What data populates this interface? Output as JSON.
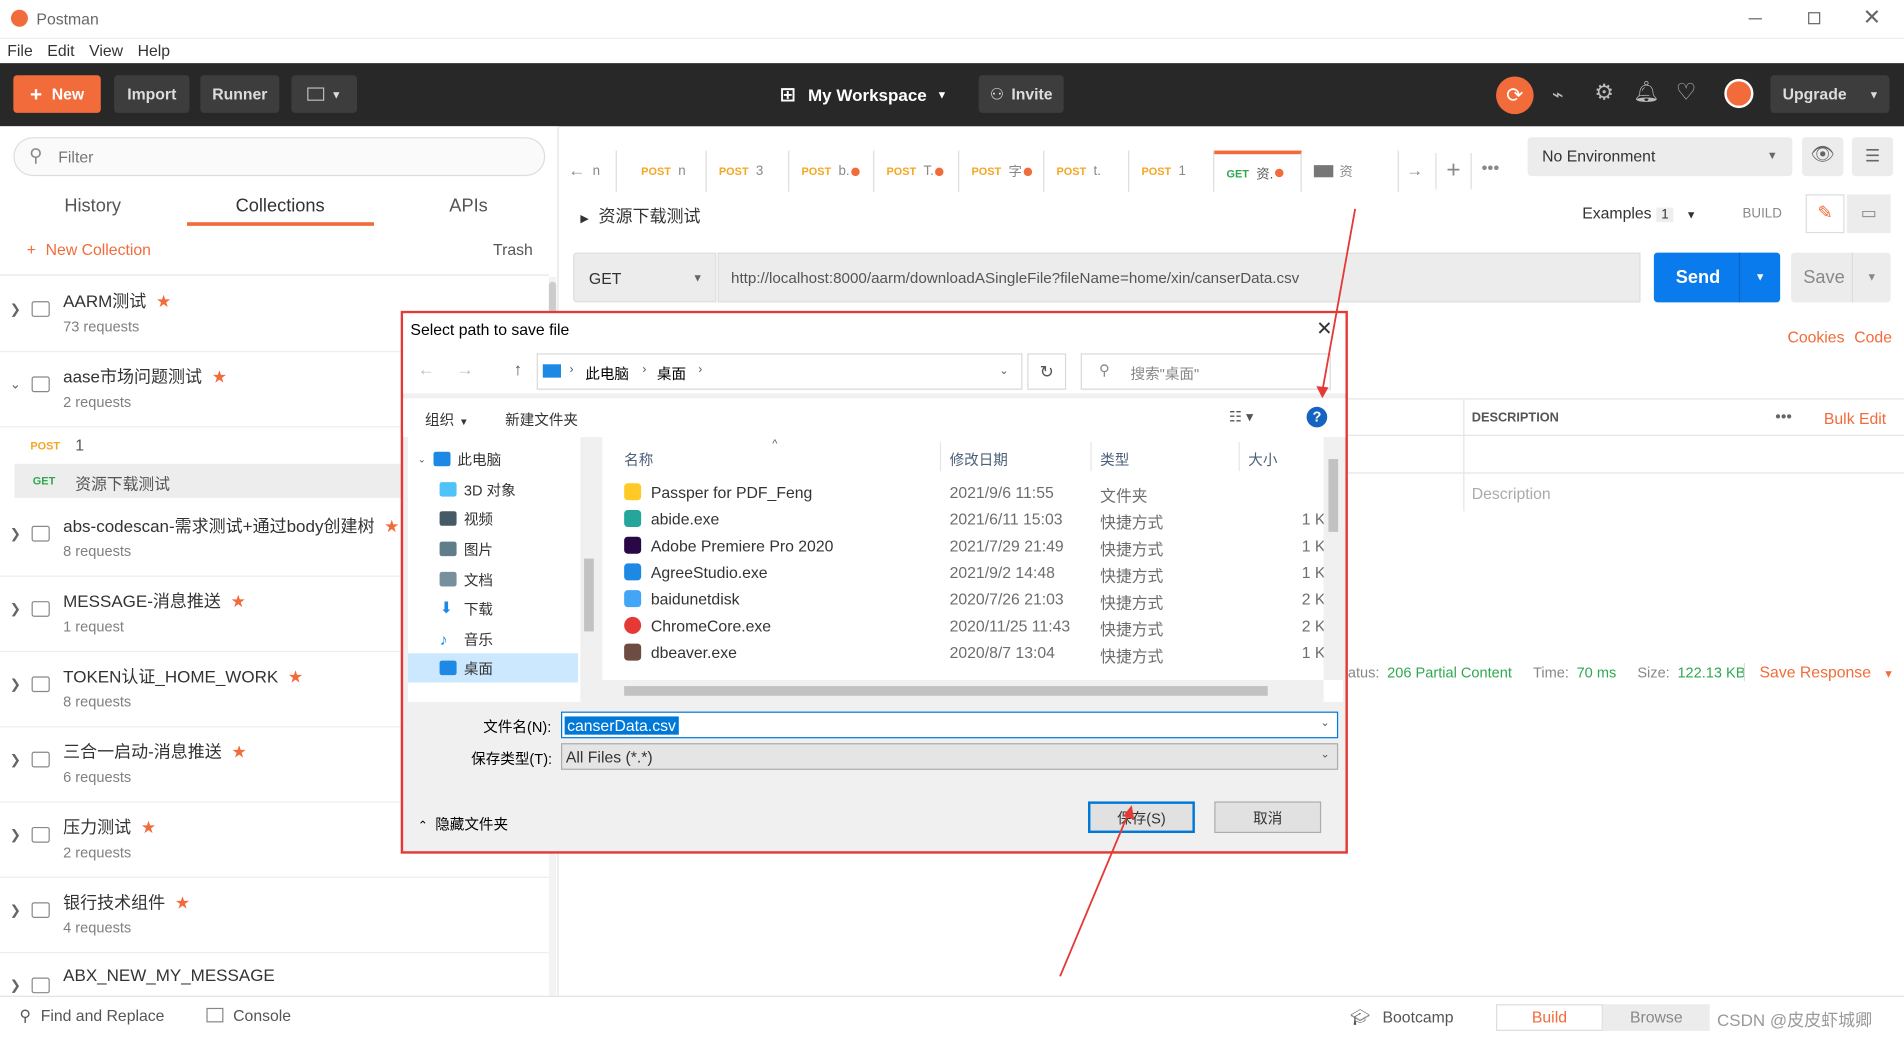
{
  "window": {
    "title": "Postman"
  },
  "menu": [
    "File",
    "Edit",
    "View",
    "Help"
  ],
  "header": {
    "new_label": "New",
    "import_label": "Import",
    "runner_label": "Runner",
    "workspace_label": "My Workspace",
    "invite_label": "Invite",
    "upgrade_label": "Upgrade"
  },
  "sidebar": {
    "filter_placeholder": "Filter",
    "tabs": [
      "History",
      "Collections",
      "APIs"
    ],
    "new_collection_label": "New Collection",
    "trash_label": "Trash",
    "collections": [
      {
        "name": "AARM测试",
        "count": "73 requests"
      },
      {
        "name": "aase市场问题测试",
        "count": "2 requests"
      },
      {
        "name": "abs-codescan-需求测试+通过body创建树",
        "count": "8 requests"
      },
      {
        "name": "MESSAGE-消息推送",
        "count": "1 request"
      },
      {
        "name": "TOKEN认证_HOME_WORK",
        "count": "8 requests"
      },
      {
        "name": "三合一启动-消息推送",
        "count": "6 requests"
      },
      {
        "name": "压力测试",
        "count": "2 requests"
      },
      {
        "name": "银行技术组件",
        "count": "4 requests"
      },
      {
        "name": "ABX_NEW_MY_MESSAGE",
        "count": ""
      }
    ],
    "requests": [
      {
        "method": "POST",
        "name": "1"
      },
      {
        "method": "GET",
        "name": "资源下载测试"
      }
    ]
  },
  "tabs": [
    {
      "method": "POST",
      "name": "n",
      "dot": false
    },
    {
      "method": "POST",
      "name": "3",
      "dot": false
    },
    {
      "method": "POST",
      "name": "b.",
      "dot": true
    },
    {
      "method": "POST",
      "name": "T.",
      "dot": true
    },
    {
      "method": "POST",
      "name": "字",
      "dot": true
    },
    {
      "method": "POST",
      "name": "t.",
      "dot": false
    },
    {
      "method": "POST",
      "name": "1",
      "dot": false
    },
    {
      "method": "GET",
      "name": "资.",
      "dot": true
    },
    {
      "method": "",
      "name": "资",
      "dot": false
    }
  ],
  "environment": {
    "selected": "No Environment"
  },
  "request": {
    "title": "资源下载测试",
    "examples_label": "Examples",
    "examples_count": "1",
    "build_label": "BUILD",
    "method": "GET",
    "url": "http://localhost:8000/aarm/downloadASingleFile?fileName=home/xin/canserData.csv",
    "send_label": "Send",
    "save_label": "Save",
    "cookies_label": "Cookies",
    "code_label": "Code",
    "description_header": "DESCRIPTION",
    "bulk_edit_label": "Bulk Edit",
    "description_placeholder": "Description"
  },
  "response": {
    "status_label": "atus:",
    "status_value": "206 Partial Content",
    "time_label": "Time:",
    "time_value": "70 ms",
    "size_label": "Size:",
    "size_value": "122.13 KB",
    "save_response_label": "Save Response"
  },
  "statusbar": {
    "find_replace": "Find and Replace",
    "console": "Console",
    "bootcamp": "Bootcamp",
    "build": "Build",
    "browse": "Browse",
    "watermark": "CSDN @皮皮虾城卿"
  },
  "dialog": {
    "title": "Select path to save file",
    "breadcrumb": [
      "此电脑",
      "桌面"
    ],
    "search_placeholder": "搜索\"桌面\"",
    "organize_label": "组织",
    "new_folder_label": "新建文件夹",
    "tree": [
      "此电脑",
      "3D 对象",
      "视频",
      "图片",
      "文档",
      "下载",
      "音乐",
      "桌面"
    ],
    "columns": [
      "名称",
      "修改日期",
      "类型",
      "大小"
    ],
    "files": [
      {
        "name": "Passper for PDF_Feng",
        "date": "2021/9/6 11:55",
        "type": "文件夹",
        "size": ""
      },
      {
        "name": "abide.exe",
        "date": "2021/6/11 15:03",
        "type": "快捷方式",
        "size": "1 K"
      },
      {
        "name": "Adobe Premiere Pro 2020",
        "date": "2021/7/29 21:49",
        "type": "快捷方式",
        "size": "1 K"
      },
      {
        "name": "AgreeStudio.exe",
        "date": "2021/9/2 14:48",
        "type": "快捷方式",
        "size": "1 K"
      },
      {
        "name": "baidunetdisk",
        "date": "2020/7/26 21:03",
        "type": "快捷方式",
        "size": "2 K"
      },
      {
        "name": "ChromeCore.exe",
        "date": "2020/11/25 11:43",
        "type": "快捷方式",
        "size": "2 K"
      },
      {
        "name": "dbeaver.exe",
        "date": "2020/8/7 13:04",
        "type": "快捷方式",
        "size": "1 K"
      }
    ],
    "filename_label": "文件名(N):",
    "filename_value": "canserData.csv",
    "filetype_label": "保存类型(T):",
    "filetype_value": "All Files (*.*)",
    "hide_folders_label": "隐藏文件夹",
    "save_button": "保存(S)",
    "cancel_button": "取消"
  },
  "colors": {
    "accent": "#f26b3a",
    "send": "#097bed",
    "dialog_border": "#e53935",
    "success": "#2fa84f"
  }
}
